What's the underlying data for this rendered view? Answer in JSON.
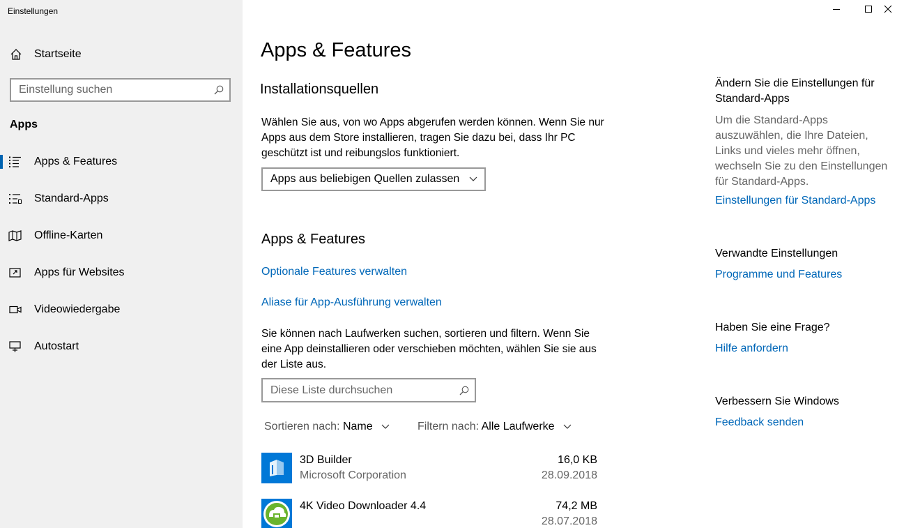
{
  "window": {
    "title": "Einstellungen",
    "controls": {
      "minimize": "minimize",
      "maximize": "maximize",
      "close": "close"
    }
  },
  "sidebar": {
    "home": {
      "label": "Startseite",
      "icon": "home-icon"
    },
    "search": {
      "placeholder": "Einstellung suchen",
      "icon": "search-icon"
    },
    "section": "Apps",
    "items": [
      {
        "label": "Apps & Features",
        "icon": "apps-list-icon",
        "active": true
      },
      {
        "label": "Standard-Apps",
        "icon": "default-apps-icon",
        "active": false
      },
      {
        "label": "Offline-Karten",
        "icon": "map-icon",
        "active": false
      },
      {
        "label": "Apps für Websites",
        "icon": "open-web-icon",
        "active": false
      },
      {
        "label": "Videowiedergabe",
        "icon": "video-icon",
        "active": false
      },
      {
        "label": "Autostart",
        "icon": "startup-icon",
        "active": false
      }
    ]
  },
  "main": {
    "title": "Apps & Features",
    "install_sources": {
      "heading": "Installationsquellen",
      "description": "Wählen Sie aus, von wo Apps abgerufen werden können. Wenn Sie nur Apps aus dem Store installieren, tragen Sie dazu bei, dass Ihr PC geschützt ist und reibungslos funktioniert.",
      "dropdown_value": "Apps aus beliebigen Quellen zulassen"
    },
    "apps_features": {
      "heading": "Apps & Features",
      "link_optional": "Optionale Features verwalten",
      "link_aliases": "Aliase für App-Ausführung verwalten",
      "description": "Sie können nach Laufwerken suchen, sortieren und filtern. Wenn Sie eine App deinstallieren oder verschieben möchten, wählen Sie sie aus der Liste aus.",
      "search_placeholder": "Diese Liste durchsuchen",
      "sort_label": "Sortieren nach:",
      "sort_value": "Name",
      "filter_label": "Filtern nach:",
      "filter_value": "Alle Laufwerke"
    },
    "apps": [
      {
        "name": "3D Builder",
        "publisher": "Microsoft Corporation",
        "size": "16,0 KB",
        "date": "28.09.2018",
        "icon": "3d-builder-icon",
        "color": "#0078d7"
      },
      {
        "name": "4K Video Downloader 4.4",
        "publisher": "",
        "size": "74,2 MB",
        "date": "28.07.2018",
        "icon": "4k-video-downloader-icon",
        "color": "#6ab42d"
      }
    ]
  },
  "right": {
    "default_apps": {
      "heading": "Ändern Sie die Einstellungen für Standard-Apps",
      "description": "Um die Standard-Apps auszuwählen, die Ihre Dateien, Links und vieles mehr öffnen, wechseln Sie zu den Einstellungen für Standard-Apps.",
      "link": "Einstellungen für Standard-Apps"
    },
    "related": {
      "heading": "Verwandte Einstellungen",
      "link": "Programme und Features"
    },
    "question": {
      "heading": "Haben Sie eine Frage?",
      "link": "Hilfe anfordern"
    },
    "improve": {
      "heading": "Verbessern Sie Windows",
      "link": "Feedback senden"
    }
  },
  "colors": {
    "accent": "#0067b8",
    "sidebar_bg": "#f0f0f0",
    "secondary_text": "#666666"
  }
}
